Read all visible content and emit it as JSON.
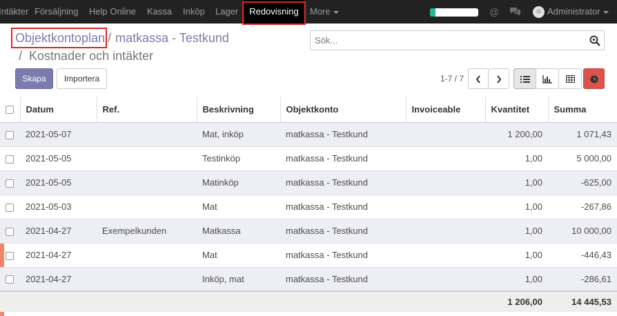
{
  "navbar": {
    "menu": [
      {
        "label": "Intäkter"
      },
      {
        "label": "Försäljning"
      },
      {
        "label": "Help Online"
      },
      {
        "label": "Kassa"
      },
      {
        "label": "Inköp"
      },
      {
        "label": "Lager"
      },
      {
        "label": "Redovisning",
        "active": true
      },
      {
        "label": "More"
      }
    ],
    "progress_fraction": 0.12,
    "user": "Administrator",
    "colors": {
      "bar": "#222222",
      "accent": "#7c7bad",
      "highlight": "#e02020",
      "progress": "#21b799"
    }
  },
  "breadcrumb": {
    "root": "Objektkontoplan",
    "separator": "/",
    "current": "matkassa - Testkund",
    "sub": "Kostnader och intäkter"
  },
  "search": {
    "placeholder": "Sök..."
  },
  "buttons": {
    "create": "Skapa",
    "import": "Importera"
  },
  "pager": {
    "range": "1-7 / 7"
  },
  "icons": [
    "search-icon",
    "chevron-left-icon",
    "chevron-right-icon",
    "list-view-icon",
    "graph-view-icon",
    "pivot-view-icon",
    "clock-icon",
    "at-icon",
    "chat-icon",
    "caret-down-icon"
  ],
  "table": {
    "columns": [
      "Datum",
      "Ref.",
      "Beskrivning",
      "Objektkonto",
      "Invoiceable",
      "Kvantitet",
      "Summa"
    ],
    "rows": [
      {
        "date": "2021-05-07",
        "ref": "",
        "desc": "Mat, inköp",
        "account": "matkassa - Testkund",
        "invoiceable": "",
        "qty": "1 200,00",
        "sum": "1 071,43"
      },
      {
        "date": "2021-05-05",
        "ref": "",
        "desc": "Testinköp",
        "account": "matkassa - Testkund",
        "invoiceable": "",
        "qty": "1,00",
        "sum": "5 000,00"
      },
      {
        "date": "2021-05-05",
        "ref": "",
        "desc": "Matinköp",
        "account": "matkassa - Testkund",
        "invoiceable": "",
        "qty": "1,00",
        "sum": "-625,00"
      },
      {
        "date": "2021-05-03",
        "ref": "",
        "desc": "Mat",
        "account": "matkassa - Testkund",
        "invoiceable": "",
        "qty": "1,00",
        "sum": "-267,86"
      },
      {
        "date": "2021-04-27",
        "ref": "Exempelkunden",
        "desc": "Matkassa",
        "account": "matkassa - Testkund",
        "invoiceable": "",
        "qty": "1,00",
        "sum": "10 000,00"
      },
      {
        "date": "2021-04-27",
        "ref": "",
        "desc": "Mat",
        "account": "matkassa - Testkund",
        "invoiceable": "",
        "qty": "1,00",
        "sum": "-446,43"
      },
      {
        "date": "2021-04-27",
        "ref": "",
        "desc": "Inköp, mat",
        "account": "matkassa - Testkund",
        "invoiceable": "",
        "qty": "1,00",
        "sum": "-286,61"
      }
    ],
    "totals": {
      "qty": "1 206,00",
      "sum": "14 445,53"
    }
  }
}
